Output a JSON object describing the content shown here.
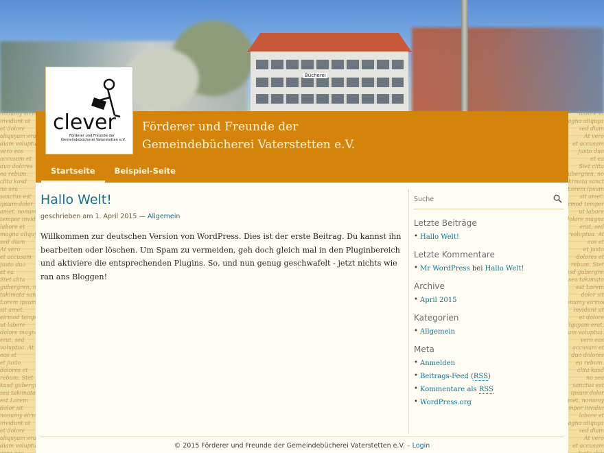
{
  "site": {
    "title_line1": "Förderer und Freunde der",
    "title_line2": "Gemeindebücherei Vaterstetten e.V.",
    "logo": {
      "wordmark": "clever",
      "subtitle_line1": "Förderer und Freunde der",
      "subtitle_line2": "Gemeindebücherei Vaterstetten e.V."
    },
    "header_sign": "Bücherei"
  },
  "nav": {
    "items": [
      {
        "label": "Startseite",
        "active": true
      },
      {
        "label": "Beispiel-Seite",
        "active": false
      }
    ]
  },
  "post": {
    "title": "Hallo Welt!",
    "meta_prefix": "geschrieben am 1. April 2015 —",
    "category": "Allgemein",
    "body": "Willkommen zur deutschen Version von WordPress. Dies ist der erste Beitrag. Du kannst ihn bearbeiten oder löschen. Um Spam zu vermeiden, geh doch gleich mal in den Pluginbereich und aktiviere die entsprechenden Plugins. So, und nun genug geschwafelt - jetzt nichts wie ran ans Bloggen!"
  },
  "sidebar": {
    "search_placeholder": "Suche",
    "recent_posts": {
      "title": "Letzte Beiträge",
      "items": [
        "Hallo Welt!"
      ]
    },
    "recent_comments": {
      "title": "Letzte Kommentare",
      "author": "Mr WordPress",
      "connector": "bei",
      "post": "Hallo Welt!"
    },
    "archive": {
      "title": "Archive",
      "items": [
        "April 2015"
      ]
    },
    "categories": {
      "title": "Kategorien",
      "items": [
        "Allgemein"
      ]
    },
    "meta": {
      "title": "Meta",
      "login": "Anmelden",
      "posts_feed_prefix": "Beitrags-Feed (",
      "posts_feed_rss": "RSS",
      "posts_feed_suffix": ")",
      "comments_feed_prefix": "Kommentare als ",
      "comments_feed_rss": "RSS",
      "wordpress": "WordPress.org"
    }
  },
  "footer": {
    "copyright": "© 2015 Förderer und Freunde der Gemeindebücherei Vaterstetten e.V.",
    "separator": "–",
    "login": "Login"
  },
  "background_text": "nonumy eirmod tempor invidunt ut labore et dolore magna aliquyam erat, sed diam voluptua. At vero eos et accusam et justo duo dolores et ea rebum. Stet clita kasd gubergren, no sea takimata sanctus est Lorem ipsum dolor sit amet.",
  "colors": {
    "accent": "#d4840a",
    "link": "#137290",
    "content_bg": "#fffdf4",
    "page_bg": "#f4dfa2"
  }
}
